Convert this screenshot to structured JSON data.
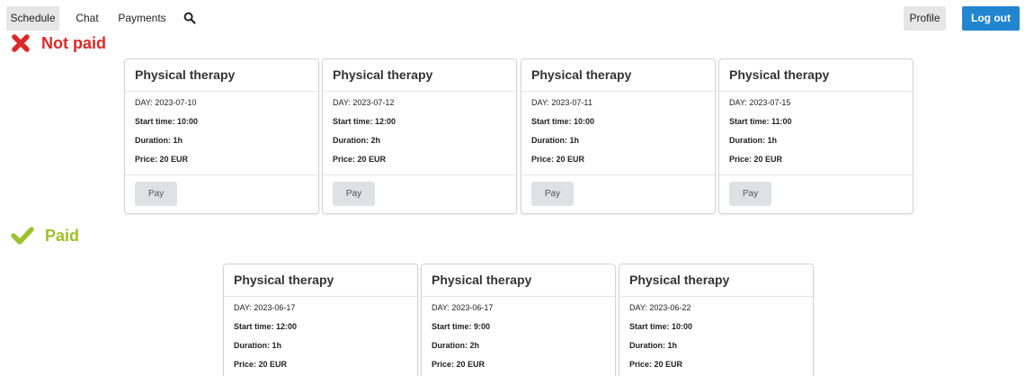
{
  "nav": {
    "tabs": [
      "Schedule",
      "Chat",
      "Payments"
    ],
    "search_icon": "search-icon",
    "profile_label": "Profile",
    "logout_label": "Log out"
  },
  "colors": {
    "not_paid": "#db2828",
    "paid": "#9cc12b",
    "primary": "#2185d0"
  },
  "sections": {
    "not_paid": {
      "label": "Not paid",
      "icon": "x-mark-icon",
      "cards": [
        {
          "title": "Physical therapy",
          "day": "DAY: 2023-07-10",
          "start": "Start time: 10:00",
          "duration": "Duration: 1h",
          "price": "Price: 20 EUR",
          "pay_label": "Pay"
        },
        {
          "title": "Physical therapy",
          "day": "DAY: 2023-07-12",
          "start": "Start time: 12:00",
          "duration": "Duration: 2h",
          "price": "Price: 20 EUR",
          "pay_label": "Pay"
        },
        {
          "title": "Physical therapy",
          "day": "DAY: 2023-07-11",
          "start": "Start time: 10:00",
          "duration": "Duration: 1h",
          "price": "Price: 20 EUR",
          "pay_label": "Pay"
        },
        {
          "title": "Physical therapy",
          "day": "DAY: 2023-07-15",
          "start": "Start time: 11:00",
          "duration": "Duration: 1h",
          "price": "Price: 20 EUR",
          "pay_label": "Pay"
        }
      ]
    },
    "paid": {
      "label": "Paid",
      "icon": "checkmark-icon",
      "cards": [
        {
          "title": "Physical therapy",
          "day": "DAY: 2023-06-17",
          "start": "Start time: 12:00",
          "duration": "Duration: 1h",
          "price": "Price: 20 EUR"
        },
        {
          "title": "Physical therapy",
          "day": "DAY: 2023-06-17",
          "start": "Start time: 9:00",
          "duration": "Duration: 2h",
          "price": "Price: 20 EUR"
        },
        {
          "title": "Physical therapy",
          "day": "DAY: 2023-06-22",
          "start": "Start time: 10:00",
          "duration": "Duration: 1h",
          "price": "Price: 20 EUR"
        }
      ]
    }
  }
}
